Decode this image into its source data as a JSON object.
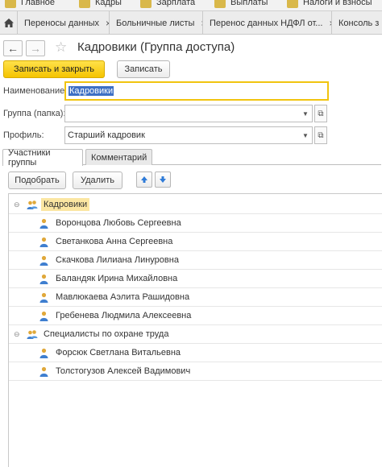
{
  "top_menu": {
    "items": [
      {
        "label": "Главное"
      },
      {
        "label": "Кадры"
      },
      {
        "label": "Зарплата"
      },
      {
        "label": "Выплаты"
      },
      {
        "label": "Налоги и взносы"
      }
    ]
  },
  "open_tabs": [
    {
      "label": "Переносы данных"
    },
    {
      "label": "Больничные листы"
    },
    {
      "label": "Перенос данных НДФЛ от..."
    },
    {
      "label": "Консоль з"
    }
  ],
  "header": {
    "title": "Кадровики (Группа доступа)"
  },
  "toolbar": {
    "save_close_label": "Записать и закрыть",
    "save_label": "Записать"
  },
  "form": {
    "name_label": "Наименование:",
    "name_value": "Кадровики",
    "group_label": "Группа (папка):",
    "group_value": "",
    "profile_label": "Профиль:",
    "profile_value": "Старший кадровик"
  },
  "form_tabs": [
    {
      "label": "Участники группы",
      "active": true
    },
    {
      "label": "Комментарий",
      "active": false
    }
  ],
  "members_toolbar": {
    "pick_label": "Подобрать",
    "delete_label": "Удалить"
  },
  "tree": [
    {
      "label": "Кадровики",
      "type": "group",
      "highlighted": true
    },
    {
      "label": "Воронцова Любовь Сергеевна",
      "type": "user"
    },
    {
      "label": "Светанкова Анна Сергеевна",
      "type": "user"
    },
    {
      "label": "Скачкова Лилиана Линуровна",
      "type": "user"
    },
    {
      "label": "Баландяк Ирина Михайловна",
      "type": "user"
    },
    {
      "label": "Мавлюкаева Аэлита Рашидовна",
      "type": "user"
    },
    {
      "label": "Гребенева Людмила Алексеевна",
      "type": "user"
    },
    {
      "label": "Специалисты по охране труда",
      "type": "group",
      "highlighted": false
    },
    {
      "label": "Форсюк Светлана Витальевна",
      "type": "user"
    },
    {
      "label": "Толстогузов Алексей Вадимович",
      "type": "user"
    }
  ],
  "colors": {
    "accent_yellow": "#f5c400",
    "selection_blue": "#3d6fc4",
    "highlight": "#fbe6a2"
  }
}
